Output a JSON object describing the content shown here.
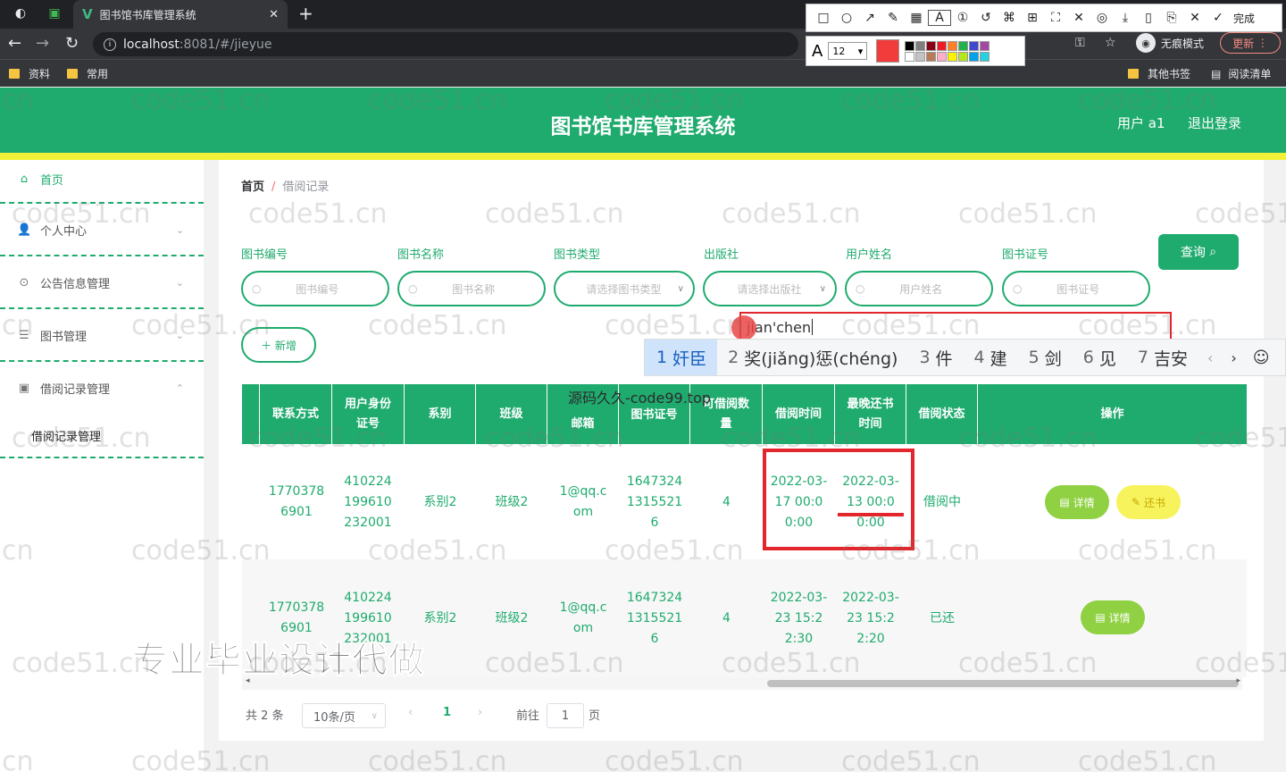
{
  "browser": {
    "tab_title": "图书馆书库管理系统",
    "url_host": "localhost",
    "url_path": ":8081/#/jieyue",
    "bookmarks": [
      "资料",
      "常用"
    ],
    "bookmarks_right": [
      "其他书签",
      "阅读清单"
    ],
    "incognito_label": "无痕模式",
    "update_label": "更新"
  },
  "snip_tool": {
    "done_label": "完成",
    "font_size": "12",
    "current_color": "#f23b3b",
    "palette": [
      "#000000",
      "#7f7f7f",
      "#880015",
      "#ed1c24",
      "#ff7f27",
      "#22b14c",
      "#3f48cc",
      "#a349a4",
      "#ffffff",
      "#c3c3c3",
      "#b97a57",
      "#ffaec9",
      "#fff200",
      "#b5e61d",
      "#00a2e8",
      "#26d0e0"
    ]
  },
  "header": {
    "title": "图书馆书库管理系统",
    "user": "用户 a1",
    "logout": "退出登录"
  },
  "sidebar": {
    "items": [
      {
        "label": "首页"
      },
      {
        "label": "个人中心"
      },
      {
        "label": "公告信息管理"
      },
      {
        "label": "图书管理"
      },
      {
        "label": "借阅记录管理"
      },
      {
        "label": "借阅记录管理"
      }
    ]
  },
  "breadcrumb": {
    "home": "首页",
    "sep": "/",
    "current": "借阅记录"
  },
  "filters": [
    {
      "label": "图书编号",
      "placeholder": "图书编号"
    },
    {
      "label": "图书名称",
      "placeholder": "图书名称"
    },
    {
      "label": "图书类型",
      "placeholder": "请选择图书类型"
    },
    {
      "label": "出版社",
      "placeholder": "请选择出版社"
    },
    {
      "label": "用户姓名",
      "placeholder": "用户姓名"
    },
    {
      "label": "图书证号",
      "placeholder": "图书证号"
    }
  ],
  "buttons": {
    "query": "查询",
    "add": "新增",
    "detail": "详情",
    "return": "还书"
  },
  "ime": {
    "composition": "jian'chen",
    "candidates": [
      {
        "num": "1",
        "text": "奸臣"
      },
      {
        "num": "2",
        "text": "奖(jiǎng)惩(chéng)"
      },
      {
        "num": "3",
        "text": "件"
      },
      {
        "num": "4",
        "text": "建"
      },
      {
        "num": "5",
        "text": "剑"
      },
      {
        "num": "6",
        "text": "见"
      },
      {
        "num": "7",
        "text": "吉安"
      }
    ]
  },
  "table": {
    "headers": [
      "联系方式",
      "用户身份证号",
      "系别",
      "班级",
      "邮箱",
      "图书证号",
      "可借阅数量",
      "借阅时间",
      "最晚还书时间",
      "借阅状态",
      "操作"
    ],
    "rows": [
      [
        "17703786901",
        "410224199610232001",
        "系别2",
        "班级2",
        "1@qq.com",
        "16473241315521 6",
        "4",
        "2022-03-17 00:00:00",
        "2022-03-13 00:00:00",
        "借阅中"
      ],
      [
        "17703786901",
        "410224199610232001",
        "系别2",
        "班级2",
        "1@qq.com",
        "16473241315521 6",
        "4",
        "2022-03-23 15:22:30",
        "2022-03-23 15:22:20",
        "已还"
      ]
    ]
  },
  "pagination": {
    "total": "共 2 条",
    "page_size": "10条/页",
    "current_page": "1",
    "goto_label": "前往",
    "goto_value": "1",
    "page_suffix": "页"
  },
  "overlay": {
    "watermark": "code51.cn",
    "center_text": "源码久久-code99.top",
    "promo": "专业毕业设计代做"
  }
}
